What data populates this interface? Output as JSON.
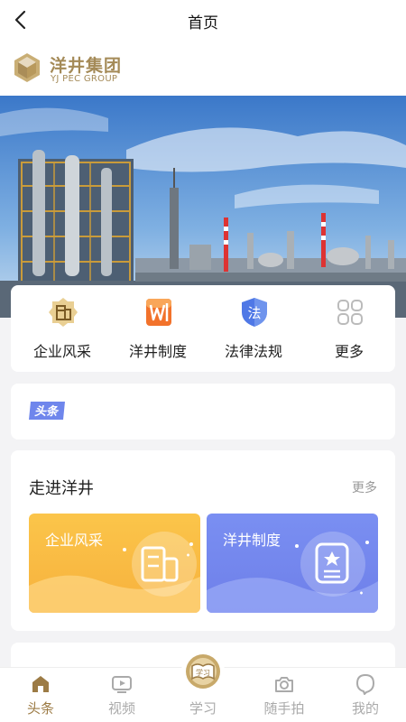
{
  "nav": {
    "title": "首页"
  },
  "brand": {
    "name_cn": "洋井集团",
    "name_en": "YJ PEC GROUP"
  },
  "quick_links": [
    {
      "label": "企业风采",
      "icon": "enterprise-icon"
    },
    {
      "label": "洋井制度",
      "icon": "regulation-book-icon"
    },
    {
      "label": "法律法规",
      "icon": "law-shield-icon"
    },
    {
      "label": "更多",
      "icon": "more-grid-icon"
    }
  ],
  "headline": {
    "badge": "头条"
  },
  "section": {
    "title": "走进洋井",
    "more": "更多",
    "cards": [
      {
        "label": "企业风采",
        "color": "#f8b840"
      },
      {
        "label": "洋井制度",
        "color": "#7385ee"
      }
    ]
  },
  "tabs": [
    {
      "label": "头条",
      "active": true,
      "icon": "home-icon"
    },
    {
      "label": "视频",
      "active": false,
      "icon": "video-icon"
    },
    {
      "label": "学习",
      "active": false,
      "icon": "study-book-icon",
      "badge": "学习"
    },
    {
      "label": "随手拍",
      "active": false,
      "icon": "camera-icon"
    },
    {
      "label": "我的",
      "active": false,
      "icon": "profile-icon"
    }
  ],
  "colors": {
    "brand_gold": "#a48a57",
    "active_tab": "#9c7b45",
    "inactive_tab": "#aaaaaa"
  }
}
